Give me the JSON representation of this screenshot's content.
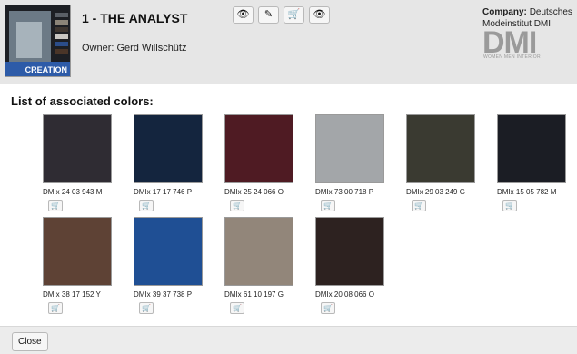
{
  "header": {
    "title": "1 - THE ANALYST",
    "owner_label": "Owner:",
    "owner_name": "Gerd Willschütz",
    "thumbnail_caption": "CREATION",
    "company_label": "Company:",
    "company_name": "Deutsches Modeinstitut DMI",
    "logo_text": "DMI",
    "logo_subtitle": "WOMEN MEN INTERIOR",
    "tools": [
      {
        "icon": "eye-icon",
        "glyph": "👁"
      },
      {
        "icon": "pencil-icon",
        "glyph": "✎"
      },
      {
        "icon": "cart-icon",
        "glyph": "🛒"
      },
      {
        "icon": "eye-slash-icon",
        "glyph": "👁"
      }
    ]
  },
  "section_title": "List of associated colors:",
  "colors": [
    {
      "code": "DMIx 24 03 943 M",
      "hex": "#2f2c33"
    },
    {
      "code": "DMIx 17 17 746 P",
      "hex": "#14253e"
    },
    {
      "code": "DMIx 25 24 066 O",
      "hex": "#4f1b23"
    },
    {
      "code": "DMIx 73 00 718 P",
      "hex": "#a3a6a9"
    },
    {
      "code": "DMIx 29 03 249 G",
      "hex": "#3a3a31"
    },
    {
      "code": "DMIx 15 05 782 M",
      "hex": "#1b1d24"
    },
    {
      "code": "DMIx 38 17 152 Y",
      "hex": "#5e4235"
    },
    {
      "code": "DMIx 39 37 738 P",
      "hex": "#1f4f94"
    },
    {
      "code": "DMIx 61 10 197 G",
      "hex": "#92867a"
    },
    {
      "code": "DMIx 20 08 066 O",
      "hex": "#2d2220"
    }
  ],
  "cart_glyph": "🛒",
  "footer": {
    "close_label": "Close"
  }
}
